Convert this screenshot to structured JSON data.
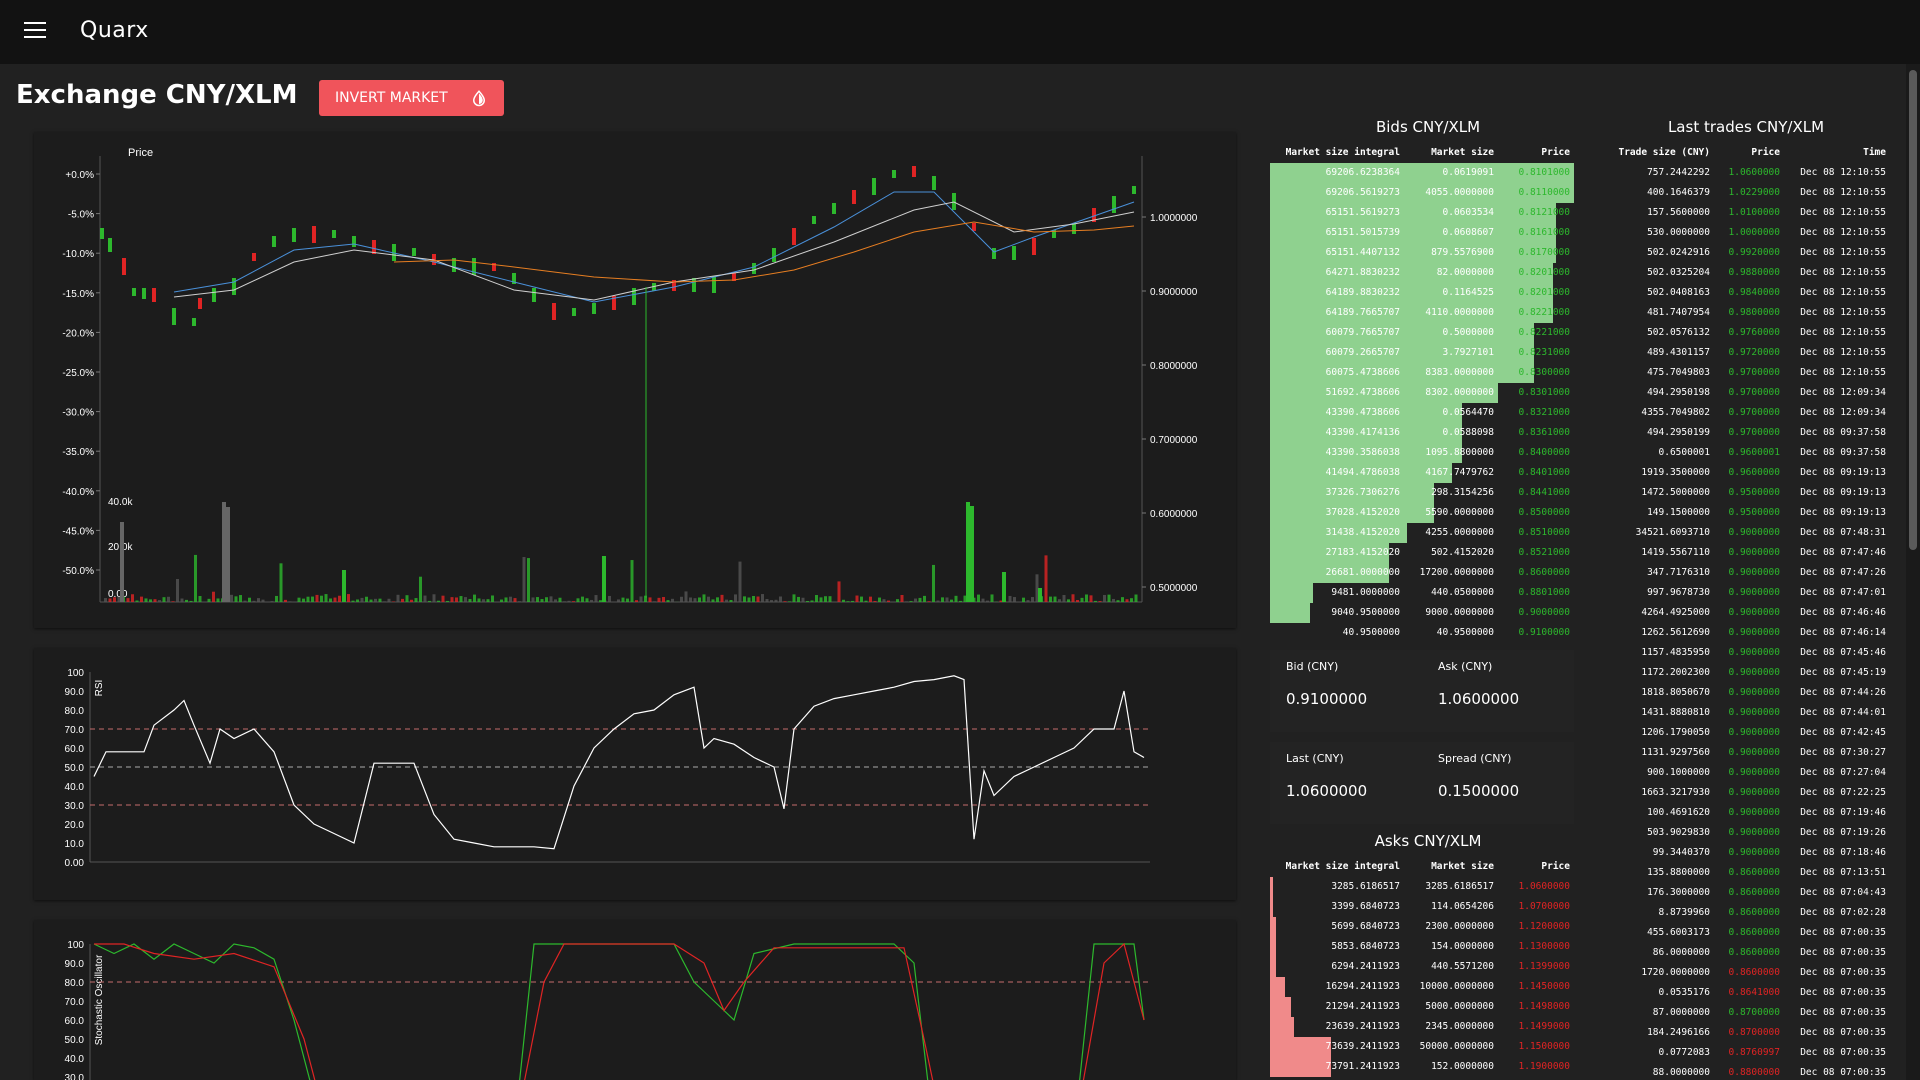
{
  "app": {
    "name": "Quarx"
  },
  "header": {
    "title": "Exchange CNY/XLM",
    "invert_label": "INVERT MARKET"
  },
  "colors": {
    "green": "#2db82d",
    "red": "#e02424",
    "bid_fill": "#8fd18f",
    "ask_fill": "#f08a8a",
    "accent": "#f0545b"
  },
  "price_chart": {
    "left_label": "Price",
    "pct_ticks": [
      "+0.0%",
      "-5.0%",
      "-10.0%",
      "-15.0%",
      "-20.0%",
      "-25.0%",
      "-30.0%",
      "-35.0%",
      "-40.0%",
      "-45.0%",
      "-50.0%"
    ],
    "price_ticks": [
      "1.0000000",
      "0.9000000",
      "0.8000000",
      "0.7000000",
      "0.6000000",
      "0.5000000"
    ],
    "volume_ticks": [
      "40.0k",
      "20.0k",
      "0.00"
    ]
  },
  "rsi_chart": {
    "label": "RSI",
    "ticks": [
      "100",
      "90.0",
      "80.0",
      "70.0",
      "60.0",
      "50.0",
      "40.0",
      "30.0",
      "20.0",
      "10.0",
      "0.00"
    ]
  },
  "stoch_chart": {
    "label": "Stochastic Oscillator",
    "ticks": [
      "100",
      "90.0",
      "80.0",
      "70.0",
      "60.0",
      "50.0",
      "40.0",
      "30.0"
    ]
  },
  "bids": {
    "title": "Bids CNY/XLM",
    "columns": [
      "Market size integral",
      "Market size",
      "Price"
    ],
    "rows": [
      {
        "integral": "69206.6238364",
        "size": "0.0619091",
        "price": "0.8101000",
        "fill": 1.0
      },
      {
        "integral": "69206.5619273",
        "size": "4055.0000000",
        "price": "0.8110000",
        "fill": 1.0
      },
      {
        "integral": "65151.5619273",
        "size": "0.0603534",
        "price": "0.8121000",
        "fill": 0.94
      },
      {
        "integral": "65151.5015739",
        "size": "0.0608607",
        "price": "0.8161000",
        "fill": 0.94
      },
      {
        "integral": "65151.4407132",
        "size": "879.5576900",
        "price": "0.8170000",
        "fill": 0.94
      },
      {
        "integral": "64271.8830232",
        "size": "82.0000000",
        "price": "0.8201000",
        "fill": 0.93
      },
      {
        "integral": "64189.8830232",
        "size": "0.1164525",
        "price": "0.8201000",
        "fill": 0.93
      },
      {
        "integral": "64189.7665707",
        "size": "4110.0000000",
        "price": "0.8221000",
        "fill": 0.93
      },
      {
        "integral": "60079.7665707",
        "size": "0.5000000",
        "price": "0.8221000",
        "fill": 0.87
      },
      {
        "integral": "60079.2665707",
        "size": "3.7927101",
        "price": "0.8231000",
        "fill": 0.87
      },
      {
        "integral": "60075.4738606",
        "size": "8383.0000000",
        "price": "0.8300000",
        "fill": 0.87
      },
      {
        "integral": "51692.4738606",
        "size": "8302.0000000",
        "price": "0.8301000",
        "fill": 0.75
      },
      {
        "integral": "43390.4738606",
        "size": "0.0564470",
        "price": "0.8321000",
        "fill": 0.63
      },
      {
        "integral": "43390.4174136",
        "size": "0.0588098",
        "price": "0.8361000",
        "fill": 0.63
      },
      {
        "integral": "43390.3586038",
        "size": "1095.8800000",
        "price": "0.8400000",
        "fill": 0.63
      },
      {
        "integral": "41494.4786038",
        "size": "4167.7479762",
        "price": "0.8401000",
        "fill": 0.6
      },
      {
        "integral": "37326.7306276",
        "size": "298.3154256",
        "price": "0.8441000",
        "fill": 0.54
      },
      {
        "integral": "37028.4152020",
        "size": "5590.0000000",
        "price": "0.8500000",
        "fill": 0.54
      },
      {
        "integral": "31438.4152020",
        "size": "4255.0000000",
        "price": "0.8510000",
        "fill": 0.45
      },
      {
        "integral": "27183.4152020",
        "size": "502.4152020",
        "price": "0.8521000",
        "fill": 0.39
      },
      {
        "integral": "26681.0000000",
        "size": "17200.0000000",
        "price": "0.8600000",
        "fill": 0.39
      },
      {
        "integral": "9481.0000000",
        "size": "440.0500000",
        "price": "0.8801000",
        "fill": 0.14
      },
      {
        "integral": "9040.9500000",
        "size": "9000.0000000",
        "price": "0.9000000",
        "fill": 0.13
      },
      {
        "integral": "40.9500000",
        "size": "40.9500000",
        "price": "0.9100000",
        "fill": 0.0
      }
    ]
  },
  "stats": {
    "bid_label": "Bid (CNY)",
    "bid_value": "0.9100000",
    "ask_label": "Ask (CNY)",
    "ask_value": "1.0600000",
    "last_label": "Last (CNY)",
    "last_value": "1.0600000",
    "spread_label": "Spread (CNY)",
    "spread_value": "0.1500000"
  },
  "asks": {
    "title": "Asks CNY/XLM",
    "columns": [
      "Market size integral",
      "Market size",
      "Price"
    ],
    "rows": [
      {
        "integral": "3285.6186517",
        "size": "3285.6186517",
        "price": "1.0600000",
        "fill": 0.01
      },
      {
        "integral": "3399.6840723",
        "size": "114.0654206",
        "price": "1.0700000",
        "fill": 0.01
      },
      {
        "integral": "5699.6840723",
        "size": "2300.0000000",
        "price": "1.1200000",
        "fill": 0.02
      },
      {
        "integral": "5853.6840723",
        "size": "154.0000000",
        "price": "1.1300000",
        "fill": 0.02
      },
      {
        "integral": "6294.2411923",
        "size": "440.5571200",
        "price": "1.1399000",
        "fill": 0.02
      },
      {
        "integral": "16294.2411923",
        "size": "10000.0000000",
        "price": "1.1450000",
        "fill": 0.05
      },
      {
        "integral": "21294.2411923",
        "size": "5000.0000000",
        "price": "1.1498000",
        "fill": 0.07
      },
      {
        "integral": "23639.2411923",
        "size": "2345.0000000",
        "price": "1.1499000",
        "fill": 0.08
      },
      {
        "integral": "73639.2411923",
        "size": "50000.0000000",
        "price": "1.1500000",
        "fill": 0.2
      },
      {
        "integral": "73791.2411923",
        "size": "152.0000000",
        "price": "1.1900000",
        "fill": 0.2
      }
    ]
  },
  "trades": {
    "title": "Last trades CNY/XLM",
    "columns": [
      "Trade size (CNY)",
      "Price",
      "Time"
    ],
    "rows": [
      {
        "size": "757.2442292",
        "price": "1.0600000",
        "time": "Dec 08 12:10:55",
        "side": "buy"
      },
      {
        "size": "400.1646379",
        "price": "1.0229000",
        "time": "Dec 08 12:10:55",
        "side": "buy"
      },
      {
        "size": "157.5600000",
        "price": "1.0100000",
        "time": "Dec 08 12:10:55",
        "side": "buy"
      },
      {
        "size": "530.0000000",
        "price": "1.0000000",
        "time": "Dec 08 12:10:55",
        "side": "buy"
      },
      {
        "size": "502.0242916",
        "price": "0.9920000",
        "time": "Dec 08 12:10:55",
        "side": "buy"
      },
      {
        "size": "502.0325204",
        "price": "0.9880000",
        "time": "Dec 08 12:10:55",
        "side": "buy"
      },
      {
        "size": "502.0408163",
        "price": "0.9840000",
        "time": "Dec 08 12:10:55",
        "side": "buy"
      },
      {
        "size": "481.7407954",
        "price": "0.9800000",
        "time": "Dec 08 12:10:55",
        "side": "buy"
      },
      {
        "size": "502.0576132",
        "price": "0.9760000",
        "time": "Dec 08 12:10:55",
        "side": "buy"
      },
      {
        "size": "489.4301157",
        "price": "0.9720000",
        "time": "Dec 08 12:10:55",
        "side": "buy"
      },
      {
        "size": "475.7049803",
        "price": "0.9700000",
        "time": "Dec 08 12:10:55",
        "side": "buy"
      },
      {
        "size": "494.2950198",
        "price": "0.9700000",
        "time": "Dec 08 12:09:34",
        "side": "buy"
      },
      {
        "size": "4355.7049802",
        "price": "0.9700000",
        "time": "Dec 08 12:09:34",
        "side": "buy"
      },
      {
        "size": "494.2950199",
        "price": "0.9700000",
        "time": "Dec 08 09:37:58",
        "side": "buy"
      },
      {
        "size": "0.6500001",
        "price": "0.9600001",
        "time": "Dec 08 09:37:58",
        "side": "buy"
      },
      {
        "size": "1919.3500000",
        "price": "0.9600000",
        "time": "Dec 08 09:19:13",
        "side": "buy"
      },
      {
        "size": "1472.5000000",
        "price": "0.9500000",
        "time": "Dec 08 09:19:13",
        "side": "buy"
      },
      {
        "size": "149.1500000",
        "price": "0.9500000",
        "time": "Dec 08 09:19:13",
        "side": "buy"
      },
      {
        "size": "34521.6093710",
        "price": "0.9000000",
        "time": "Dec 08 07:48:31",
        "side": "buy"
      },
      {
        "size": "1419.5567110",
        "price": "0.9000000",
        "time": "Dec 08 07:47:46",
        "side": "buy"
      },
      {
        "size": "347.7176310",
        "price": "0.9000000",
        "time": "Dec 08 07:47:26",
        "side": "buy"
      },
      {
        "size": "997.9678730",
        "price": "0.9000000",
        "time": "Dec 08 07:47:01",
        "side": "buy"
      },
      {
        "size": "4264.4925000",
        "price": "0.9000000",
        "time": "Dec 08 07:46:46",
        "side": "buy"
      },
      {
        "size": "1262.5612690",
        "price": "0.9000000",
        "time": "Dec 08 07:46:14",
        "side": "buy"
      },
      {
        "size": "1157.4835950",
        "price": "0.9000000",
        "time": "Dec 08 07:45:46",
        "side": "buy"
      },
      {
        "size": "1172.2002300",
        "price": "0.9000000",
        "time": "Dec 08 07:45:19",
        "side": "buy"
      },
      {
        "size": "1818.8050670",
        "price": "0.9000000",
        "time": "Dec 08 07:44:26",
        "side": "buy"
      },
      {
        "size": "1431.8880810",
        "price": "0.9000000",
        "time": "Dec 08 07:44:01",
        "side": "buy"
      },
      {
        "size": "1206.1790050",
        "price": "0.9000000",
        "time": "Dec 08 07:42:45",
        "side": "buy"
      },
      {
        "size": "1131.9297560",
        "price": "0.9000000",
        "time": "Dec 08 07:30:27",
        "side": "buy"
      },
      {
        "size": "900.1000000",
        "price": "0.9000000",
        "time": "Dec 08 07:27:04",
        "side": "buy"
      },
      {
        "size": "1663.3217930",
        "price": "0.9000000",
        "time": "Dec 08 07:22:25",
        "side": "buy"
      },
      {
        "size": "100.4691620",
        "price": "0.9000000",
        "time": "Dec 08 07:19:46",
        "side": "buy"
      },
      {
        "size": "503.9029830",
        "price": "0.9000000",
        "time": "Dec 08 07:19:26",
        "side": "buy"
      },
      {
        "size": "99.3440370",
        "price": "0.9000000",
        "time": "Dec 08 07:18:46",
        "side": "buy"
      },
      {
        "size": "135.8800000",
        "price": "0.8600000",
        "time": "Dec 08 07:13:51",
        "side": "buy"
      },
      {
        "size": "176.3000000",
        "price": "0.8600000",
        "time": "Dec 08 07:04:43",
        "side": "buy"
      },
      {
        "size": "8.8739960",
        "price": "0.8600000",
        "time": "Dec 08 07:02:28",
        "side": "buy"
      },
      {
        "size": "455.6003173",
        "price": "0.8600000",
        "time": "Dec 08 07:00:35",
        "side": "buy"
      },
      {
        "size": "86.0000000",
        "price": "0.8600000",
        "time": "Dec 08 07:00:35",
        "side": "buy"
      },
      {
        "size": "1720.0000000",
        "price": "0.8600000",
        "time": "Dec 08 07:00:35",
        "side": "sell"
      },
      {
        "size": "0.0535176",
        "price": "0.8641000",
        "time": "Dec 08 07:00:35",
        "side": "sell"
      },
      {
        "size": "87.0000000",
        "price": "0.8700000",
        "time": "Dec 08 07:00:35",
        "side": "buy"
      },
      {
        "size": "184.2496166",
        "price": "0.8700000",
        "time": "Dec 08 07:00:35",
        "side": "sell"
      },
      {
        "size": "0.0772083",
        "price": "0.8760997",
        "time": "Dec 08 07:00:35",
        "side": "sell"
      },
      {
        "size": "88.0000000",
        "price": "0.8800000",
        "time": "Dec 08 07:00:35",
        "side": "sell"
      }
    ]
  }
}
